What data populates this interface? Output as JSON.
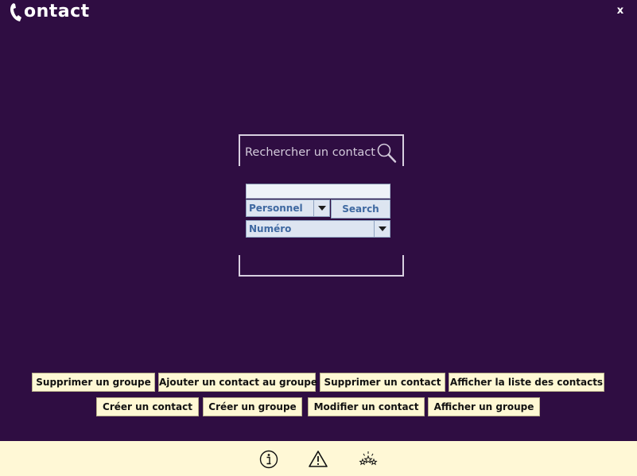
{
  "header": {
    "app_name": "ontact",
    "close_label": "x",
    "logo_icon": "phone-handset-icon"
  },
  "search": {
    "title": "Rechercher un contact",
    "icon": "magnifier-icon",
    "query_value": "",
    "type_selected": "Personnel",
    "search_button": "Search",
    "field_selected": "Numéro"
  },
  "actions": {
    "row1": [
      "Supprimer un groupe",
      "Ajouter un contact au groupe",
      "Supprimer un contact",
      "Afficher la liste des contacts"
    ],
    "row2": [
      "Créer un contact",
      "Créer un groupe",
      "Modifier un contact",
      "Afficher un groupe"
    ]
  },
  "footer": {
    "icons": [
      "info-icon",
      "warning-icon",
      "stars-icon"
    ]
  },
  "colors": {
    "background": "#2f0d42",
    "footer": "#fff8d6",
    "button": "#fff8d4",
    "control": "#dde5f1",
    "control_text": "#3f69a1"
  }
}
